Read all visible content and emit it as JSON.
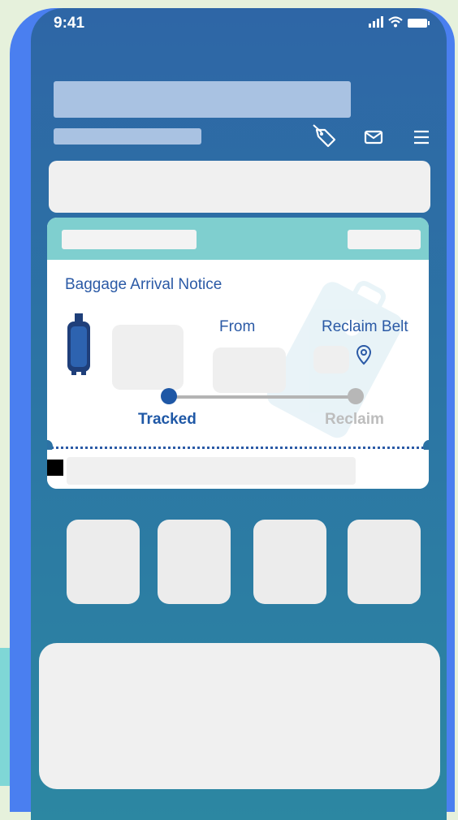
{
  "status": {
    "time": "9:41"
  },
  "card": {
    "title": "Baggage Arrival Notice",
    "from_label": "From",
    "belt_label": "Reclaim Belt",
    "progress": {
      "start_label": "Tracked",
      "end_label": "Reclaim",
      "current_step": 1,
      "total_steps": 2
    }
  },
  "icons": [
    "signal-icon",
    "wifi-icon",
    "battery-icon",
    "tag-icon",
    "mail-icon",
    "menu-icon",
    "luggage-icon",
    "location-pin-icon"
  ],
  "colors": {
    "primary": "#1f58a6",
    "accent": "#7fcfcf",
    "frame": "#4a7ff0",
    "inactive": "#b7b7b7"
  }
}
